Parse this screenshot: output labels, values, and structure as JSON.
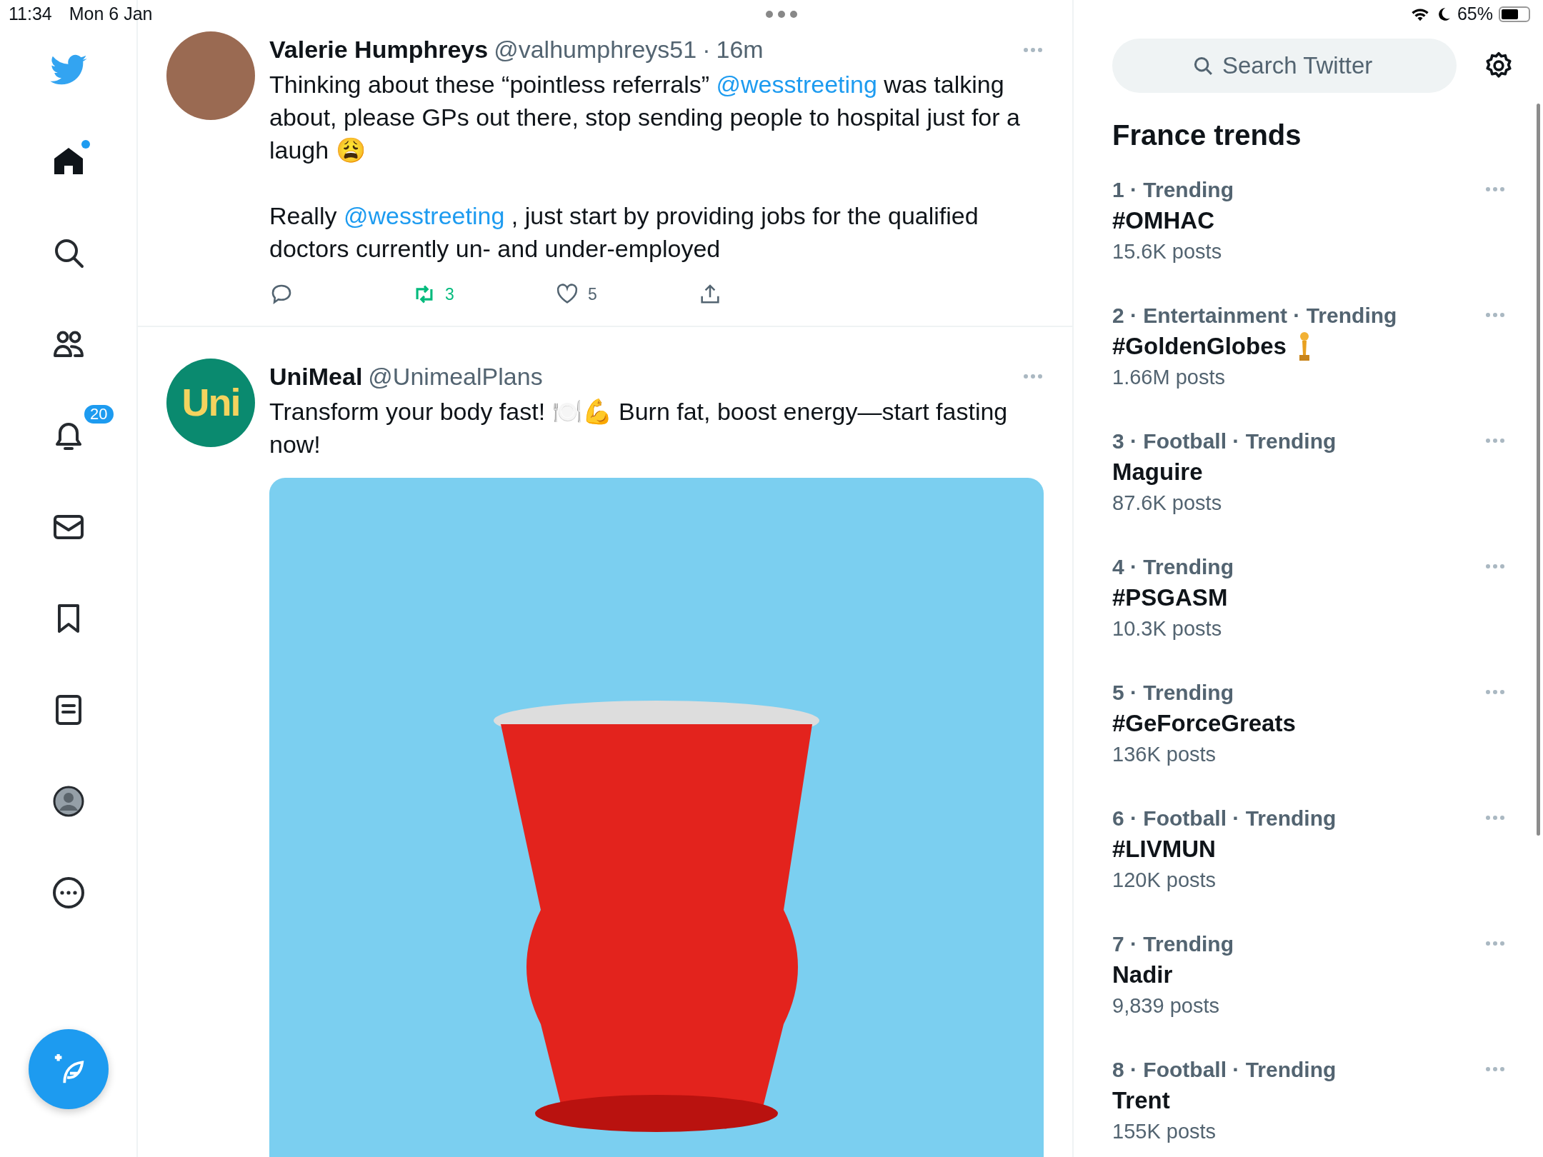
{
  "status_bar": {
    "time": "11:34",
    "date": "Mon 6 Jan",
    "battery": "65%"
  },
  "nav": {
    "items": [
      {
        "kind": "logo",
        "selected": false
      },
      {
        "kind": "home",
        "selected": true,
        "unread": true
      },
      {
        "kind": "search",
        "selected": false
      },
      {
        "kind": "communities",
        "selected": false
      },
      {
        "kind": "notifications",
        "selected": false,
        "badge": "20"
      },
      {
        "kind": "messages",
        "selected": false
      },
      {
        "kind": "bookmarks",
        "selected": false
      },
      {
        "kind": "lists",
        "selected": false
      },
      {
        "kind": "profile",
        "selected": false
      },
      {
        "kind": "more",
        "selected": false
      }
    ]
  },
  "tweets": [
    {
      "kind": "photo",
      "name": "Valerie Humphreys",
      "handle": "@valhumphreys51",
      "separator": "·",
      "time": "16m",
      "paragraphs": [
        [
          {
            "kind": "plain",
            "text": "Thinking about these “pointless referrals” "
          },
          {
            "kind": "mention",
            "text": "@wesstreeting"
          },
          {
            "kind": "plain",
            "text": " was talking about, please GPs out there, stop sending people to hospital just for a laugh 😩"
          }
        ],
        [
          {
            "kind": "plain",
            "text": "Really "
          },
          {
            "kind": "mention",
            "text": "@wesstreeting"
          },
          {
            "kind": "plain",
            "text": " , just start by providing jobs for the qualified doctors currently un- and under-employed"
          }
        ]
      ],
      "actions": {
        "retweets": "3",
        "retweeted": true,
        "likes": "5",
        "liked": false
      }
    },
    {
      "kind": "logo",
      "logo_text": "Uni",
      "name": "UniMeal",
      "handle": "@UnimealPlans",
      "paragraphs": [
        [
          {
            "kind": "plain",
            "text": "Transform your body fast! 🍽️💪 Burn fat, boost energy—start fasting now!"
          }
        ]
      ],
      "media": true
    }
  ],
  "search": {
    "placeholder": "Search Twitter"
  },
  "trends": {
    "title": "France trends",
    "items": [
      {
        "meta": "1 · Trending",
        "name": "#OMHAC",
        "posts": "15.6K posts"
      },
      {
        "meta": "2 · Entertainment · Trending",
        "name": "#GoldenGlobes",
        "posts": "1.66M posts",
        "hashflag": true
      },
      {
        "meta": "3 · Football · Trending",
        "name": "Maguire",
        "posts": "87.6K posts"
      },
      {
        "meta": "4 · Trending",
        "name": "#PSGASM",
        "posts": "10.3K posts"
      },
      {
        "meta": "5 · Trending",
        "name": "#GeForceGreats",
        "posts": "136K posts"
      },
      {
        "meta": "6 · Football · Trending",
        "name": "#LIVMUN",
        "posts": "120K posts"
      },
      {
        "meta": "7 · Trending",
        "name": "Nadir",
        "posts": "9,839 posts"
      },
      {
        "meta": "8 · Football · Trending",
        "name": "Trent",
        "posts": "155K posts"
      }
    ]
  }
}
